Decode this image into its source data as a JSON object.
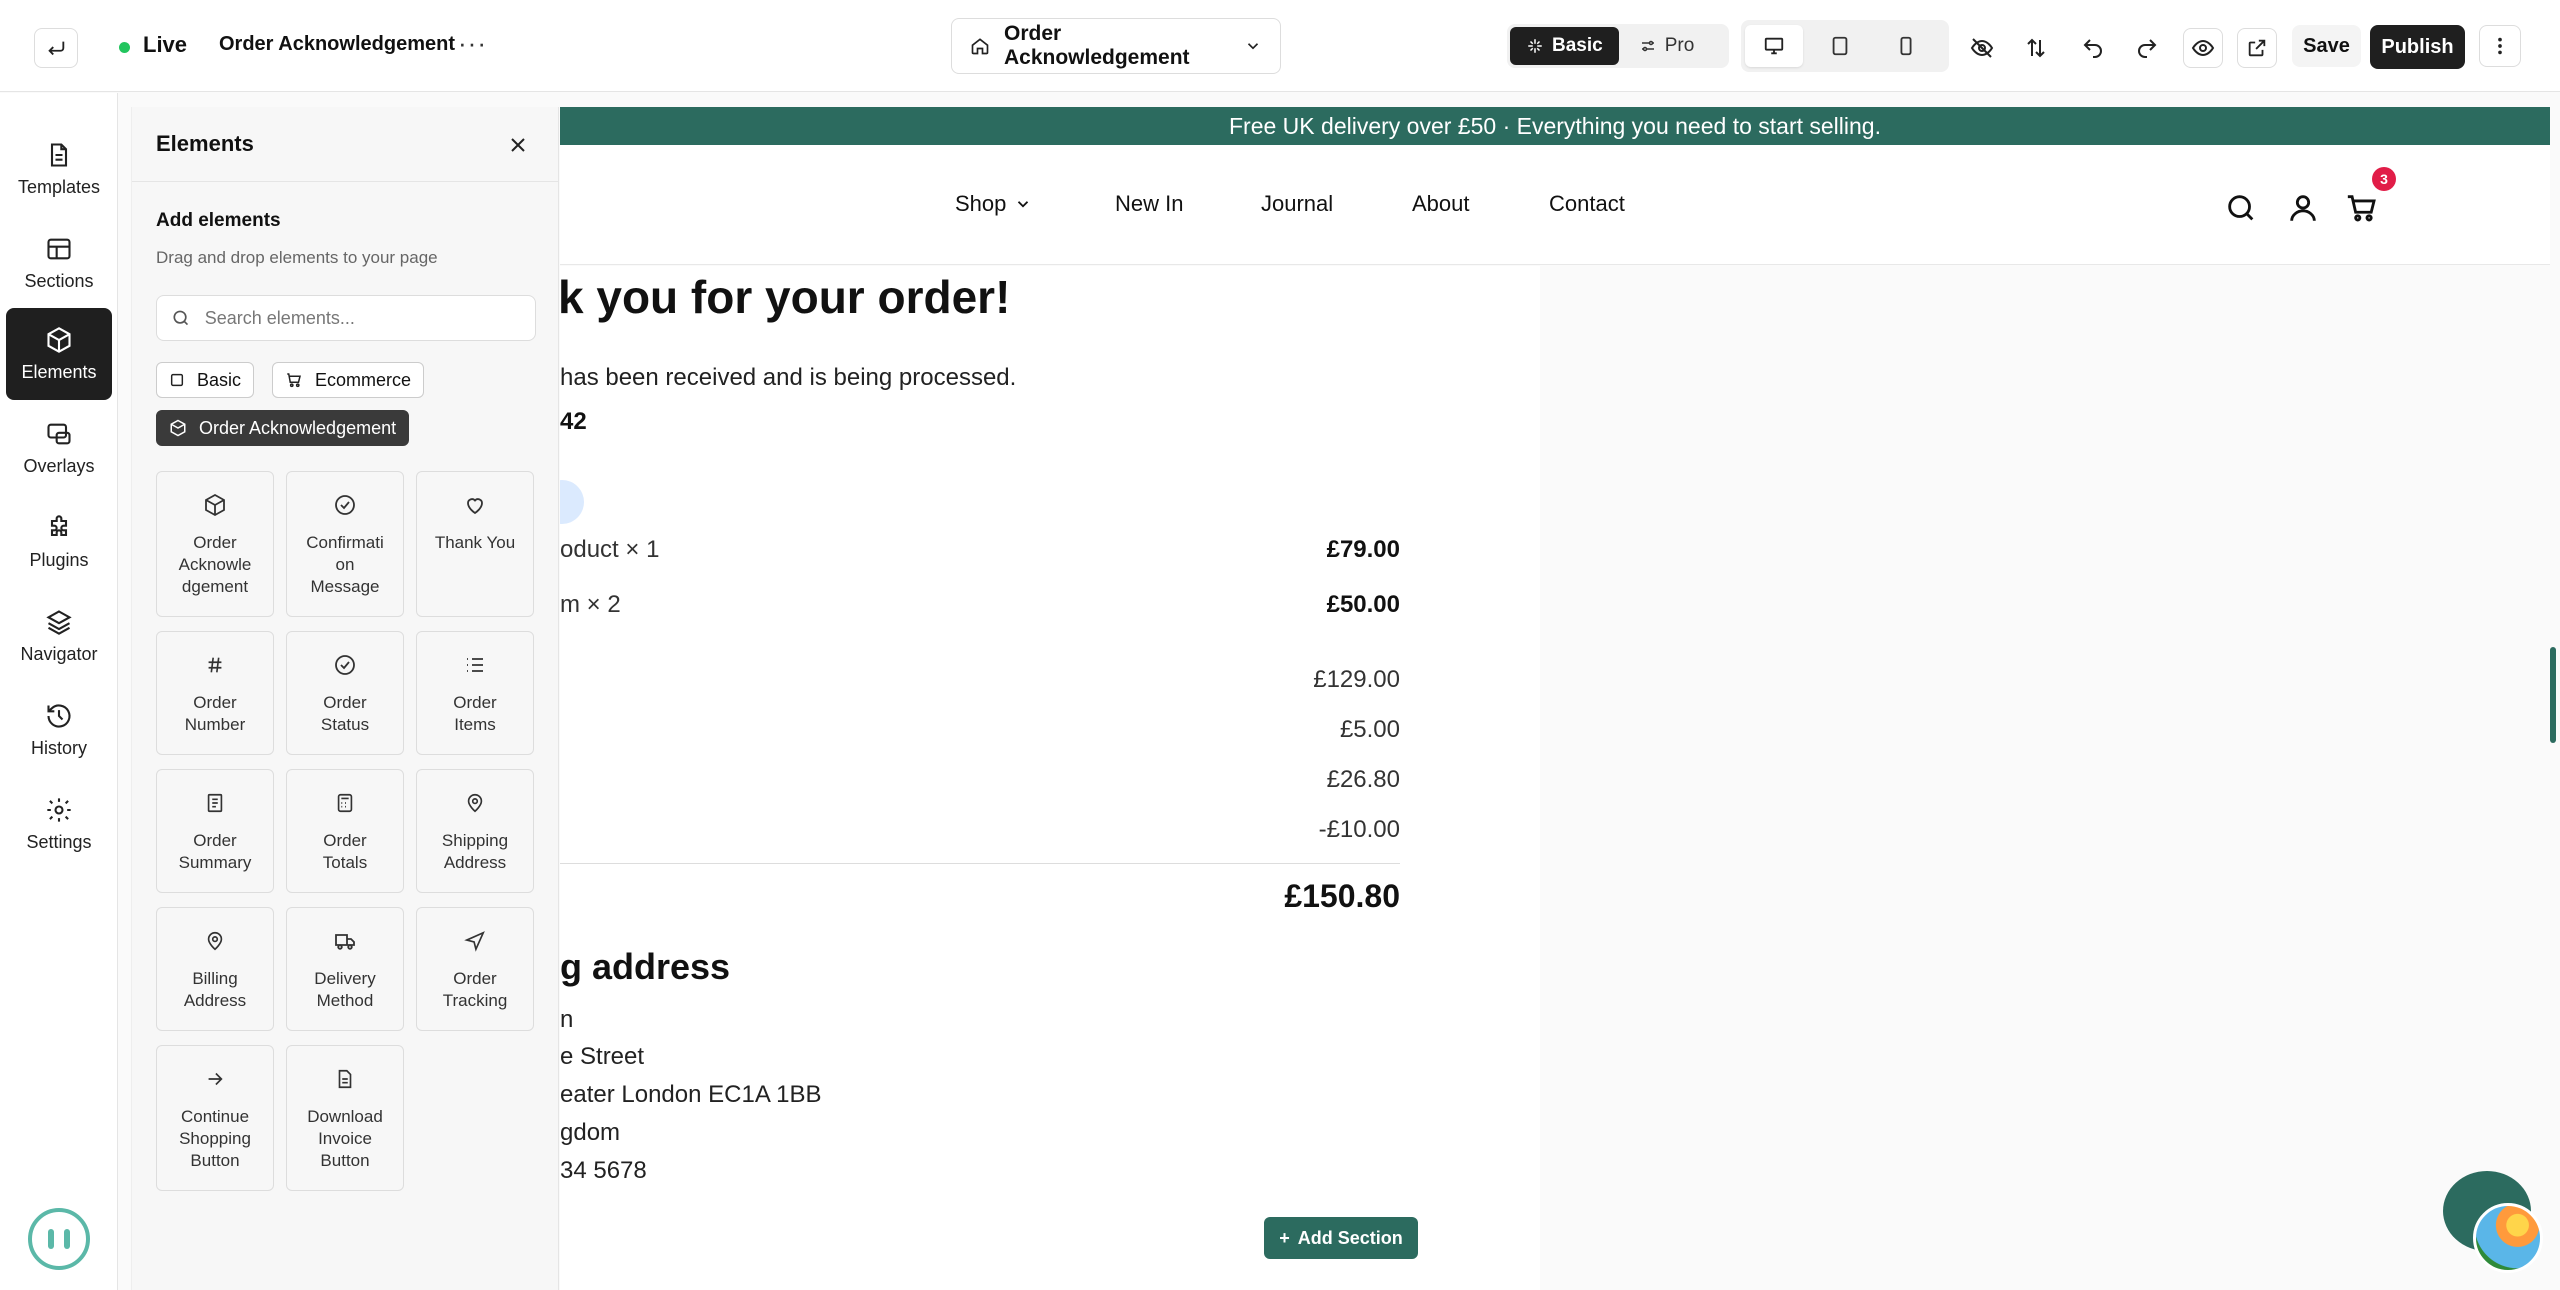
{
  "topbar": {
    "status": "Live",
    "page_name": "Order Acknowledgement",
    "page_select": "Order Acknowledgement",
    "modes": [
      "Basic",
      "Pro"
    ],
    "save_label": "Save",
    "publish_label": "Publish"
  },
  "rail": {
    "items": [
      "Templates",
      "Sections",
      "Elements",
      "Overlays",
      "Plugins",
      "Navigator",
      "History",
      "Settings"
    ],
    "active": "Elements"
  },
  "panel": {
    "title": "Elements",
    "subtitle": "Add elements",
    "description": "Drag and drop elements to your page",
    "search_placeholder": "Search elements...",
    "categories": [
      "Basic",
      "Ecommerce",
      "Order Acknowledgement"
    ],
    "active_category": "Order Acknowledgement",
    "elements": [
      "Order Acknowle dgement",
      "Confirmati on Message",
      "Thank You",
      "Order Number",
      "Order Status",
      "Order Items",
      "Order Summary",
      "Order Totals",
      "Shipping Address",
      "Billing Address",
      "Delivery Method",
      "Order Tracking",
      "Continue Shopping Button",
      "Download Invoice Button"
    ]
  },
  "site": {
    "promo": "Free UK delivery over £50 · Everything you need to start selling.",
    "nav": [
      "Shop",
      "New In",
      "Journal",
      "About",
      "Contact"
    ],
    "cart_count": "3",
    "title_visible": "k you for your order!",
    "description_visible": "has been received and is being processed.",
    "order_number_visible": "42",
    "items": [
      {
        "label": "oduct × 1",
        "amount": "£79.00"
      },
      {
        "label": "m × 2",
        "amount": "£50.00"
      }
    ],
    "summary": [
      "£129.00",
      "£5.00",
      "£26.80",
      "-£10.00"
    ],
    "total": "£150.80",
    "shipping_title": "g address",
    "address_lines": [
      "n",
      "e Street",
      "eater London EC1A 1BB",
      "gdom",
      "34 5678"
    ],
    "add_section_label": "Add Section"
  },
  "colors": {
    "brand_green": "#2c6b5f",
    "dark": "#1f1f1f",
    "live": "#22c55e",
    "badge": "#e11d48"
  }
}
